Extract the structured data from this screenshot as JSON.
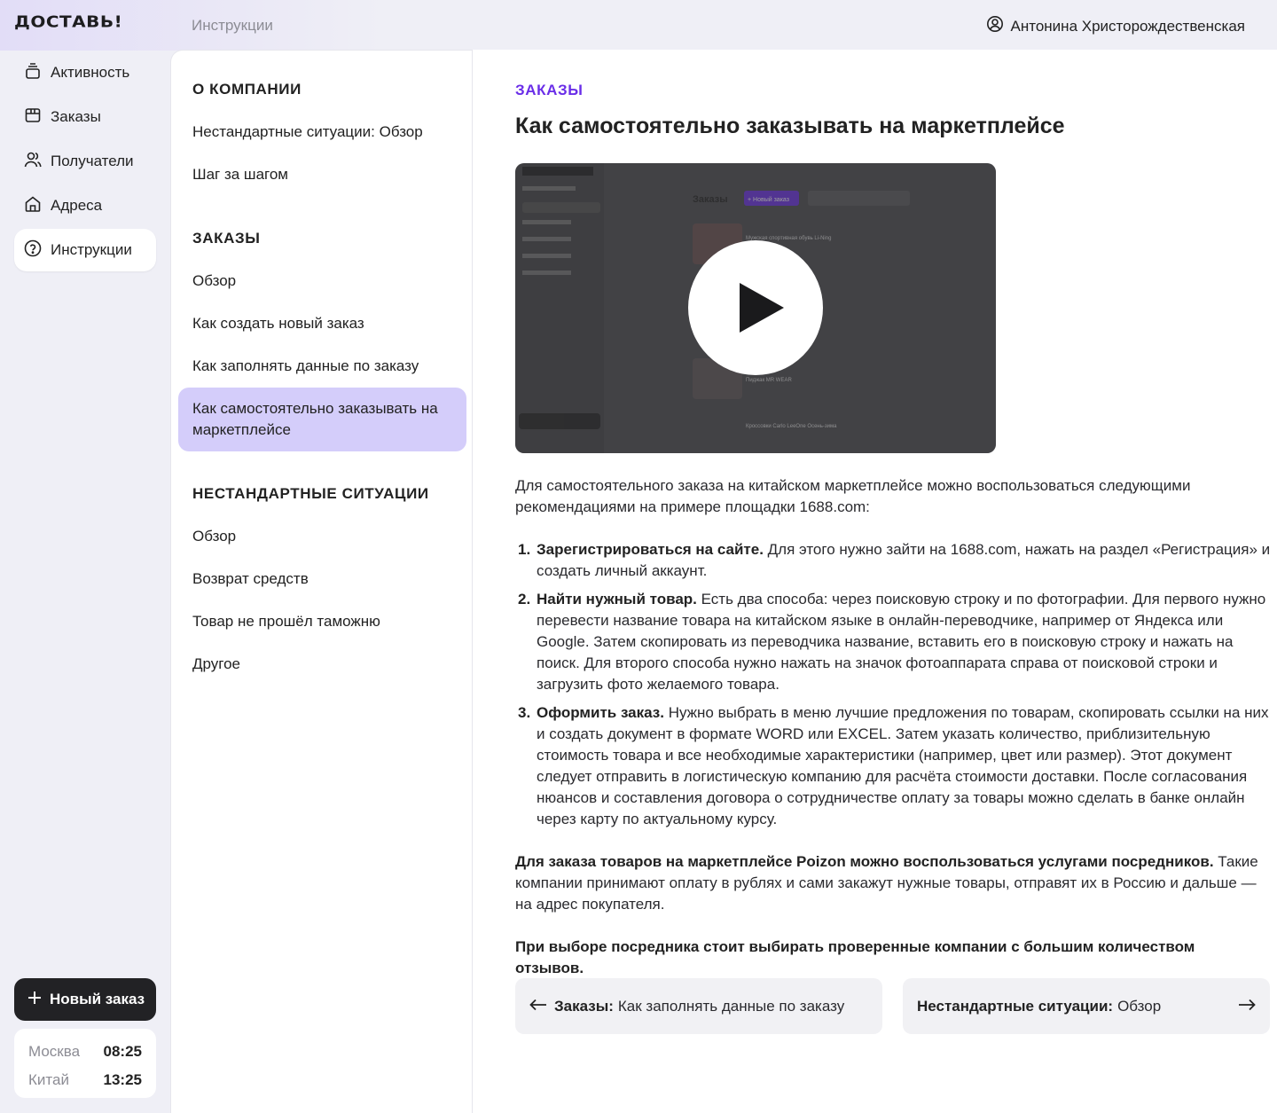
{
  "brand": {
    "logo": "ДОСТАВЬ!"
  },
  "header": {
    "breadcrumb": "Инструкции",
    "user_name": "Антонина Христорождественская"
  },
  "sidebar": {
    "items": [
      {
        "label": "Активность",
        "icon": "stack-icon"
      },
      {
        "label": "Заказы",
        "icon": "box-icon"
      },
      {
        "label": "Получатели",
        "icon": "users-icon"
      },
      {
        "label": "Адреса",
        "icon": "home-icon"
      },
      {
        "label": "Инструкции",
        "icon": "help-icon",
        "active": true
      }
    ],
    "new_order_label": "Новый заказ",
    "clocks": [
      {
        "city": "Москва",
        "time": "08:25"
      },
      {
        "city": "Китай",
        "time": "13:25"
      }
    ]
  },
  "toc": {
    "sections": [
      {
        "title": "О КОМПАНИИ",
        "items": [
          "Нестандартные ситуации: Обзор",
          "Шаг за шагом"
        ]
      },
      {
        "title": "ЗАКАЗЫ",
        "items": [
          "Обзор",
          "Как создать новый заказ",
          "Как заполнять данные по заказу",
          "Как самостоятельно заказывать на маркетплейсе"
        ]
      },
      {
        "title": "НЕСТАНДАРТНЫЕ СИТУАЦИИ",
        "items": [
          "Обзор",
          "Возврат средств",
          "Товар не прошёл таможню",
          "Другое"
        ]
      }
    ],
    "active_item": "Как самостоятельно заказывать на маркетплейсе"
  },
  "article": {
    "section": "ЗАКАЗЫ",
    "title": "Как самостоятельно заказывать на маркетплейсе",
    "intro": "Для самостоятельного заказа на китайском маркетплейсе можно воспользоваться следующими рекомендациями на примере площадки 1688.com:",
    "steps": [
      {
        "num": "1.",
        "bold": "Зарегистрироваться на сайте.",
        "text": " Для этого нужно зайти на 1688.com, нажать на раздел «Регистрация» и создать личный аккаунт."
      },
      {
        "num": "2.",
        "bold": "Найти нужный товар.",
        "text": " Есть два способа: через поисковую строку и по фотографии. Для первого нужно перевести название товара на китайском языке в онлайн-переводчике, например от Яндекса или Google. Затем скопировать из переводчика название, вставить его в поисковую строку и нажать на поиск. Для второго способа нужно нажать на значок фотоаппарата справа от поисковой строки и загрузить фото желаемого товара."
      },
      {
        "num": "3.",
        "bold": "Оформить заказ.",
        "text": " Нужно выбрать в меню лучшие предложения по товарам, скопировать ссылки на них и создать документ в формате WORD или EXCEL. Затем указать количество, приблизительную стоимость товара и все необходимые характеристики (например, цвет или размер). Этот документ следует отправить в логистическую компанию для расчёта стоимости доставки. После согласования нюансов и составления договора о сотрудничестве оплату за товары можно сделать в банке онлайн через карту по актуальному курсу."
      }
    ],
    "poizon_bold": "Для заказа товаров на маркетплейсе Poizon можно воспользоваться услугами посредников.",
    "poizon_text": " Такие компании принимают оплату в рублях и сами закажут нужные товары, отправят их в Россию и дальше — на адрес покупателя.",
    "advice": "При выборе посредника стоит выбирать проверенные компании с большим количеством отзывов.",
    "prev": {
      "section": "Заказы:",
      "title": "Как заполнять данные по заказу"
    },
    "next": {
      "section": "Нестандартные ситуации:",
      "title": "Обзор"
    }
  },
  "video": {
    "preview_header_title": "Заказы",
    "preview_new_order": "+ Новый заказ",
    "preview_items": [
      "Мужская спортивная обувь Li-Ning",
      "Пиджак MR WEAR",
      "Кроссовки Carlo LeeOne Осень-зима"
    ]
  },
  "colors": {
    "accent": "#6a2ee8",
    "active_bg": "#d4cdfa",
    "dark": "#222225"
  }
}
